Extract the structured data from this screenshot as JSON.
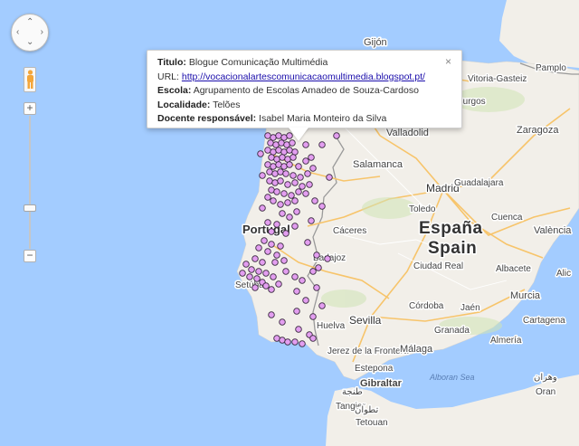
{
  "map": {
    "labels": {
      "gijon": "Gijón",
      "vitoria": "Vitoria-Gasteiz",
      "pamplona": "Pamplo",
      "burgos": "Burgos",
      "valladolid": "Valladolid",
      "zaragoza": "Zaragoza",
      "salamanca": "Salamanca",
      "madrid": "Madrid",
      "guadalajara": "Guadalajara",
      "toledo": "Toledo",
      "espana": "España",
      "spain": "Spain",
      "portugal": "Portugal",
      "caceres": "Cáceres",
      "badajoz": "Badajoz",
      "ciudad_real": "Ciudad Real",
      "cuenca": "Cuenca",
      "valencia": "València",
      "albacete": "Albacete",
      "setubal": "Setúbal",
      "huelva": "Huelva",
      "sevilla": "Sevilla",
      "cordoba": "Córdoba",
      "jaen": "Jaén",
      "murcia": "Murcia",
      "cartagena": "Cartagena",
      "alicante": "Alic",
      "granada": "Granada",
      "almeria": "Almería",
      "jerez": "Jerez de la Frontera",
      "malaga": "Málaga",
      "estepona": "Estepona",
      "gibraltar": "Gibraltar",
      "alboran": "Alboran Sea",
      "tangier": "Tangier",
      "tetouan": "Tetouan",
      "oran": "Oran",
      "tanger_ar": "طنجة",
      "tetouan_ar": "تطوان",
      "oran_ar": "وهران"
    },
    "marker_color": "#e39ef0",
    "water_color": "#a3ccff",
    "land_color": "#f2efe9"
  },
  "info_window": {
    "titulo_label": "Titulo:",
    "titulo_value": "Blogue Comunicação Multimédia",
    "url_label": "URL:",
    "url_value": "http://vocacionalartescomunicacaomultimedia.blogspot.pt/",
    "escola_label": "Escola:",
    "escola_value": "Agrupamento de Escolas Amadeo de Souza-Cardoso",
    "localidade_label": "Localidade:",
    "localidade_value": "Telões",
    "docente_label": "Docente responsável:",
    "docente_value": "Isabel Maria Monteiro da Silva",
    "close_icon": "×"
  },
  "controls": {
    "pan_up": "⌃",
    "pan_down": "⌄",
    "pan_left": "‹",
    "pan_right": "›",
    "zoom_in": "+",
    "zoom_out": "−"
  }
}
